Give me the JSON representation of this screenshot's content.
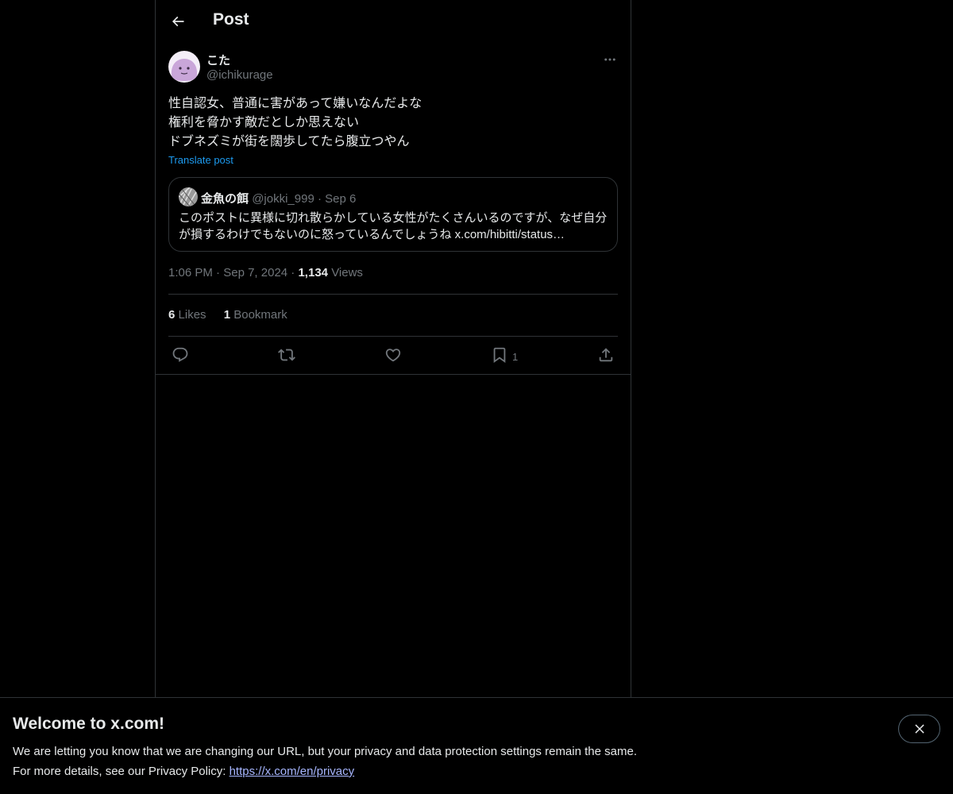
{
  "header": {
    "title": "Post",
    "back_icon": "back-arrow-icon"
  },
  "post": {
    "author_name": "こた",
    "author_handle": "@ichikurage",
    "text_lines": [
      "性自認女、普通に害があって嫌いなんだよな",
      "権利を脅かす敵だとしか思えない",
      "ドブネズミが街を闊歩してたら腹立つやん"
    ],
    "translate_label": "Translate post",
    "time": "1:06 PM",
    "date": "Sep 7, 2024",
    "views_count": "1,134",
    "views_label": "Views",
    "likes_count": "6",
    "likes_label": "Likes",
    "bookmarks_count": "1",
    "bookmarks_label": "Bookmark",
    "dot": "·"
  },
  "quote": {
    "author_name": "金魚の餌",
    "author_handle": "@jokki_999",
    "date": "Sep 6",
    "text_lines": [
      "このポストに異様に切れ散らかしている女性がたくさんいるのですが、なぜ自分",
      "が損するわけでもないのに怒っているんでしょうね x.com/hibitti/status…"
    ]
  },
  "actions": {
    "reply_icon": "reply-icon",
    "repost_icon": "repost-icon",
    "like_icon": "like-icon",
    "bookmark_icon": "bookmark-icon",
    "bookmark_count": "1",
    "share_icon": "share-icon"
  },
  "banner": {
    "title": "Welcome to x.com!",
    "line1": "We are letting you know that we are changing our URL, but your privacy and data protection settings remain the same.",
    "line2_prefix": "For more details, see our Privacy Policy: ",
    "link": "https://x.com/en/privacy",
    "close_icon": "close-icon"
  },
  "colors": {
    "background": "#000000",
    "text": "#e7e9ea",
    "muted": "#71767b",
    "accent": "#1d9bf0",
    "border": "#2f3336",
    "link": "#a7b6ff"
  }
}
